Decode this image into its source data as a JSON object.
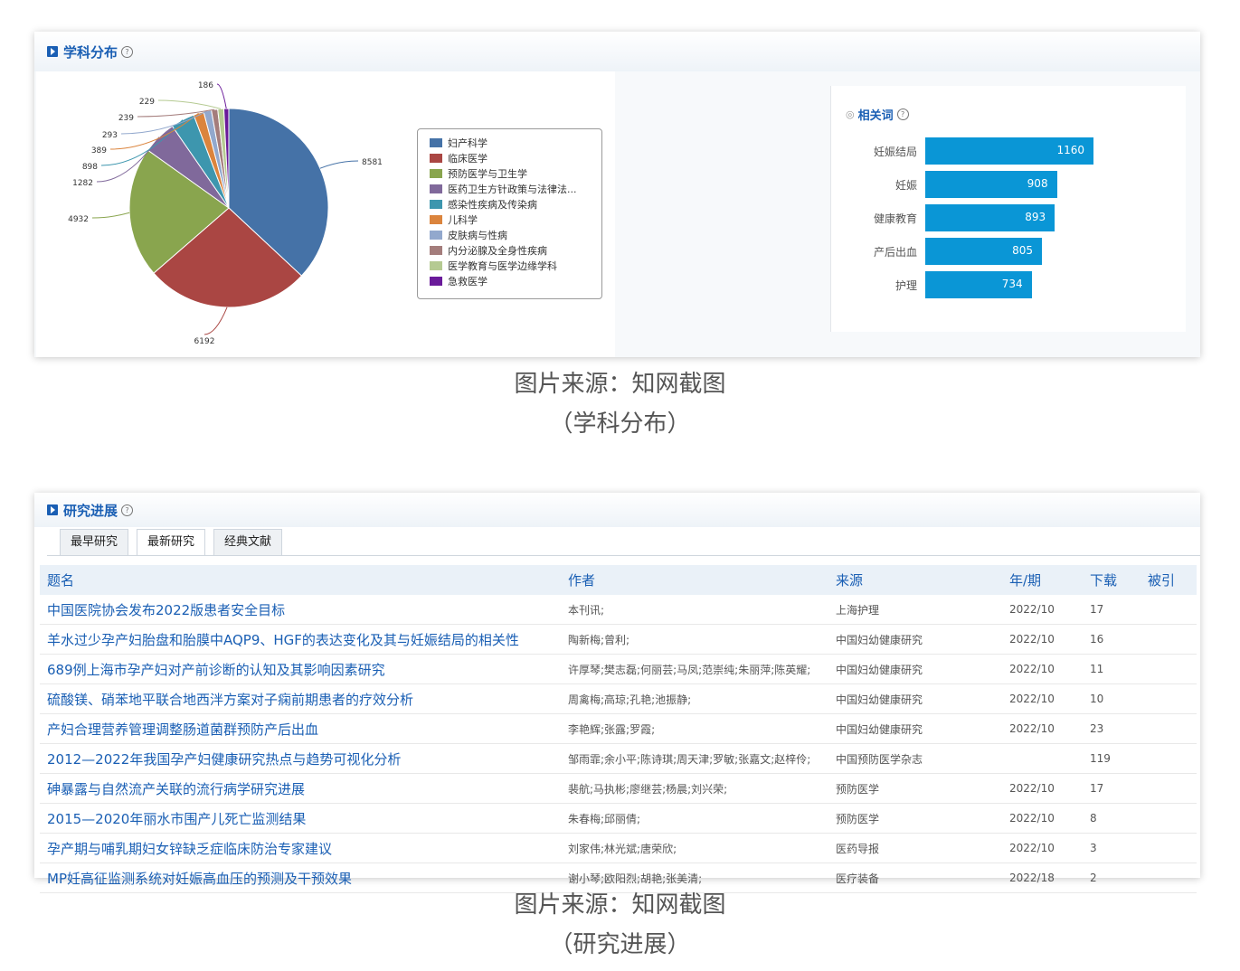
{
  "subject_panel": {
    "title": "学科分布"
  },
  "chart_data": [
    {
      "type": "pie",
      "title": "学科分布",
      "categories": [
        "妇产科学",
        "临床医学",
        "预防医学与卫生学",
        "医药卫生方针政策与法律法...",
        "感染性疾病及传染病",
        "儿科学",
        "皮肤病与性病",
        "内分泌腺及全身性疾病",
        "医学教育与医学边缘学科",
        "急救医学"
      ],
      "values": [
        8581,
        6192,
        4932,
        1282,
        898,
        389,
        293,
        239,
        229,
        186
      ],
      "colors": [
        "#4572a7",
        "#aa4643",
        "#89a54e",
        "#80699b",
        "#3d96ae",
        "#db843d",
        "#92a8cd",
        "#a47d7c",
        "#b5ca92",
        "#6a1a9a"
      ],
      "legend_position": "right"
    },
    {
      "type": "bar",
      "title": "相关词",
      "categories": [
        "妊娠结局",
        "妊娠",
        "健康教育",
        "产后出血",
        "护理"
      ],
      "values": [
        1160,
        908,
        893,
        805,
        734
      ],
      "color": "#0a96d6",
      "orientation": "horizontal"
    }
  ],
  "related": {
    "title": "相关词"
  },
  "captions": {
    "line1": "图片来源：知网截图",
    "subject": "（学科分布）",
    "progress": "（研究进展）"
  },
  "progress_panel": {
    "title": "研究进展",
    "tabs": [
      "最早研究",
      "最新研究",
      "经典文献"
    ],
    "active_tab": "最新研究",
    "columns": [
      "题名",
      "作者",
      "来源",
      "年/期",
      "下载",
      "被引"
    ],
    "rows": [
      {
        "title": "中国医院协会发布2022版患者安全目标",
        "author": "本刊讯;",
        "source": "上海护理",
        "issue": "2022/10",
        "downloads": "17",
        "cited": ""
      },
      {
        "title": "羊水过少孕产妇胎盘和胎膜中AQP9、HGF的表达变化及其与妊娠结局的相关性",
        "author": "陶新梅;曾利;",
        "source": "中国妇幼健康研究",
        "issue": "2022/10",
        "downloads": "16",
        "cited": ""
      },
      {
        "title": "689例上海市孕产妇对产前诊断的认知及其影响因素研究",
        "author": "许厚琴;樊志磊;何丽芸;马凤;范崇纯;朱丽萍;陈英耀;",
        "source": "中国妇幼健康研究",
        "issue": "2022/10",
        "downloads": "11",
        "cited": ""
      },
      {
        "title": "硫酸镁、硝苯地平联合地西泮方案对子痫前期患者的疗效分析",
        "author": "周禽梅;高琼;孔艳;池振静;",
        "source": "中国妇幼健康研究",
        "issue": "2022/10",
        "downloads": "10",
        "cited": ""
      },
      {
        "title": "产妇合理营养管理调整肠道菌群预防产后出血",
        "author": "李艳辉;张露;罗霞;",
        "source": "中国妇幼健康研究",
        "issue": "2022/10",
        "downloads": "23",
        "cited": ""
      },
      {
        "title": "2012—2022年我国孕产妇健康研究热点与趋势可视化分析",
        "author": "邹雨霏;余小平;陈诗琪;周天津;罗敏;张嘉文;赵梓伶;",
        "source": "中国预防医学杂志",
        "issue": "",
        "downloads": "119",
        "cited": ""
      },
      {
        "title": "砷暴露与自然流产关联的流行病学研究进展",
        "author": "裴航;马执彬;廖继芸;杨晨;刘兴荣;",
        "source": "预防医学",
        "issue": "2022/10",
        "downloads": "17",
        "cited": ""
      },
      {
        "title": "2015—2020年丽水市围产儿死亡监测结果",
        "author": "朱春梅;邱丽倩;",
        "source": "预防医学",
        "issue": "2022/10",
        "downloads": "8",
        "cited": ""
      },
      {
        "title": "孕产期与哺乳期妇女锌缺乏症临床防治专家建议",
        "author": "刘家伟;林光斌;唐荣欣;",
        "source": "医药导报",
        "issue": "2022/10",
        "downloads": "3",
        "cited": ""
      },
      {
        "title": "MP妊高征监测系统对妊娠高血压的预测及干预效果",
        "author": "谢小琴;欧阳烈;胡艳;张美清;",
        "source": "医疗装备",
        "issue": "2022/18",
        "downloads": "2",
        "cited": ""
      }
    ]
  }
}
